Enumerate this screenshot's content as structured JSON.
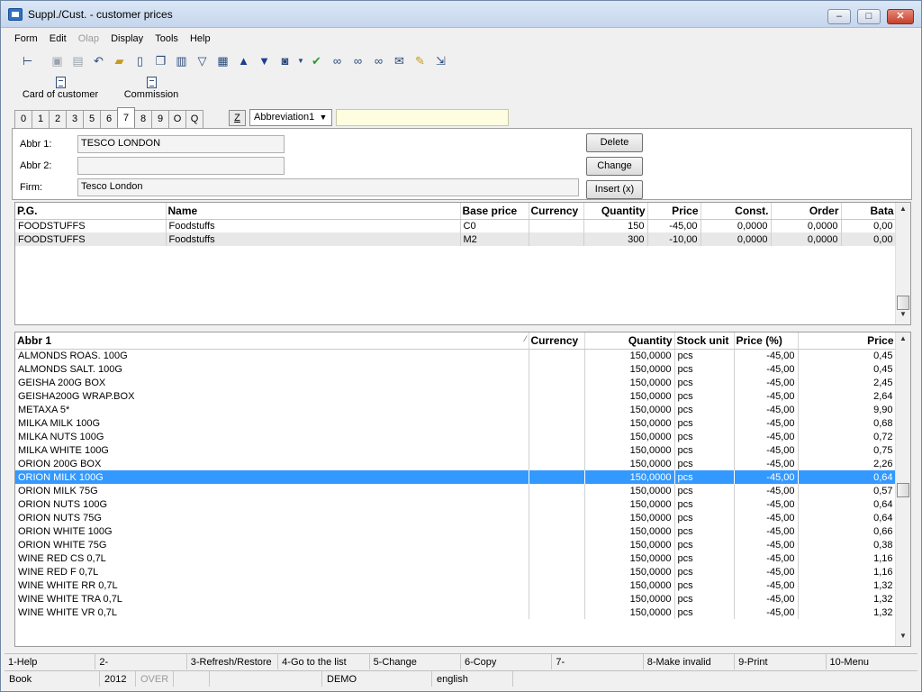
{
  "window": {
    "title": "Suppl./Cust. - customer prices",
    "controls": {
      "minimize": "–",
      "maximize": "□",
      "close": "✕"
    }
  },
  "menu": [
    {
      "label": "Form",
      "enabled": true
    },
    {
      "label": "Edit",
      "enabled": true
    },
    {
      "label": "Olap",
      "enabled": false
    },
    {
      "label": "Display",
      "enabled": true
    },
    {
      "label": "Tools",
      "enabled": true
    },
    {
      "label": "Help",
      "enabled": true
    }
  ],
  "toolbar_icons": [
    "tree-icon",
    "save-icon",
    "save-as-icon",
    "undo-icon",
    "open-folder-icon",
    "new-document-icon",
    "copy-icon",
    "book-icon",
    "filter-icon",
    "filter-edit-icon",
    "arrow-up-icon",
    "arrow-down-icon",
    "camera-icon",
    "dropdown-arrow-icon",
    "checkmark-icon",
    "binoculars-icon",
    "binoculars-next-icon",
    "binoculars-edit-icon",
    "mail-icon",
    "notepad-icon",
    "export-icon"
  ],
  "actions": {
    "card_of_customer": "Card of customer",
    "commission": "Commission"
  },
  "tabs": [
    "0",
    "1",
    "2",
    "3",
    "5",
    "6",
    "7",
    "8",
    "9",
    "O",
    "Q"
  ],
  "active_tab": "7",
  "z_button": "Z",
  "index_select": "Abbreviation1",
  "search_value": "",
  "form": {
    "abbr1_label": "Abbr 1:",
    "abbr1_value": "TESCO LONDON",
    "abbr2_label": "Abbr 2:",
    "abbr2_value": "",
    "firm_label": "Firm:",
    "firm_value": "Tesco London",
    "delete_button": "Delete",
    "change_button": "Change",
    "insert_button": "Insert (x)"
  },
  "price_groups": {
    "columns": [
      "P.G.",
      "Name",
      "Base price",
      "Currency",
      "Quantity",
      "Price",
      "Const.",
      "Order",
      "Bata"
    ],
    "rows": [
      [
        "FOODSTUFFS",
        "Foodstuffs",
        "C0",
        "",
        "150",
        "-45,00",
        "0,0000",
        "0,0000",
        "0,00"
      ],
      [
        "FOODSTUFFS",
        "Foodstuffs",
        "M2",
        "",
        "300",
        "-10,00",
        "0,0000",
        "0,0000",
        "0,00"
      ]
    ]
  },
  "items": {
    "columns": [
      "Abbr 1",
      "Currency",
      "Quantity",
      "Stock unit",
      "Price (%)",
      "Price"
    ],
    "sort_mark": "⁄",
    "selected_index": 9,
    "rows": [
      [
        "ALMONDS ROAS.  100G",
        "",
        "150,0000",
        "pcs",
        "-45,00",
        "0,45"
      ],
      [
        "ALMONDS SALT.  100G",
        "",
        "150,0000",
        "pcs",
        "-45,00",
        "0,45"
      ],
      [
        "GEISHA 200G BOX",
        "",
        "150,0000",
        "pcs",
        "-45,00",
        "2,45"
      ],
      [
        "GEISHA200G WRAP.BOX",
        "",
        "150,0000",
        "pcs",
        "-45,00",
        "2,64"
      ],
      [
        "METAXA 5*",
        "",
        "150,0000",
        "pcs",
        "-45,00",
        "9,90"
      ],
      [
        "MILKA MILK 100G",
        "",
        "150,0000",
        "pcs",
        "-45,00",
        "0,68"
      ],
      [
        "MILKA NUTS 100G",
        "",
        "150,0000",
        "pcs",
        "-45,00",
        "0,72"
      ],
      [
        "MILKA WHITE 100G",
        "",
        "150,0000",
        "pcs",
        "-45,00",
        "0,75"
      ],
      [
        "ORION 200G BOX",
        "",
        "150,0000",
        "pcs",
        "-45,00",
        "2,26"
      ],
      [
        "ORION MILK 100G",
        "",
        "150,0000",
        "pcs",
        "-45,00",
        "0,64"
      ],
      [
        "ORION MILK 75G",
        "",
        "150,0000",
        "pcs",
        "-45,00",
        "0,57"
      ],
      [
        "ORION NUTS 100G",
        "",
        "150,0000",
        "pcs",
        "-45,00",
        "0,64"
      ],
      [
        "ORION NUTS 75G",
        "",
        "150,0000",
        "pcs",
        "-45,00",
        "0,64"
      ],
      [
        "ORION WHITE 100G",
        "",
        "150,0000",
        "pcs",
        "-45,00",
        "0,66"
      ],
      [
        "ORION WHITE 75G",
        "",
        "150,0000",
        "pcs",
        "-45,00",
        "0,38"
      ],
      [
        "WINE RED CS 0,7L",
        "",
        "150,0000",
        "pcs",
        "-45,00",
        "1,16"
      ],
      [
        "WINE RED F 0,7L",
        "",
        "150,0000",
        "pcs",
        "-45,00",
        "1,16"
      ],
      [
        "WINE WHITE RR 0,7L",
        "",
        "150,0000",
        "pcs",
        "-45,00",
        "1,32"
      ],
      [
        "WINE WHITE TRA 0,7L",
        "",
        "150,0000",
        "pcs",
        "-45,00",
        "1,32"
      ],
      [
        "WINE WHITE VR 0,7L",
        "",
        "150,0000",
        "pcs",
        "-45,00",
        "1,32"
      ]
    ]
  },
  "function_keys": [
    "1-Help",
    "2-",
    "3-Refresh/Restore",
    "4-Go to the list",
    "5-Change",
    "6-Copy",
    "7-",
    "8-Make invalid",
    "9-Print",
    "10-Menu"
  ],
  "status": {
    "book": "Book",
    "year": "2012",
    "over": "OVER",
    "db": "DEMO",
    "language": "english"
  },
  "colors": {
    "selection": "#3399ff",
    "search_bg": "#fffde0"
  }
}
